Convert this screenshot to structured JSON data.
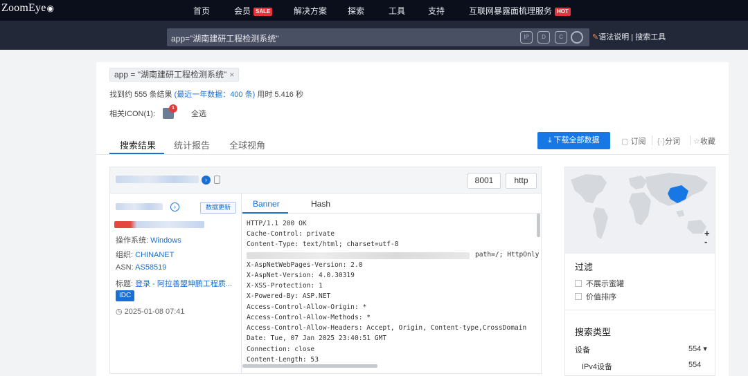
{
  "nav": {
    "logo": "ZoomEye",
    "items": [
      {
        "label": "首页"
      },
      {
        "label": "会员",
        "badge": "SALE"
      },
      {
        "label": "解决方案"
      },
      {
        "label": "探索"
      },
      {
        "label": "工具"
      },
      {
        "label": "支持"
      },
      {
        "label": "互联网暴露面梳理服务",
        "badge": "HOT"
      }
    ]
  },
  "search": {
    "query": "app=\"湖南建研工程检测系统\"",
    "help": "语法说明",
    "tools": "搜索工具",
    "divider": "|"
  },
  "filter_tag": {
    "label": "app = \"湖南建研工程检测系统\"",
    "close": "×"
  },
  "results_summary": {
    "prefix": "找到约 555 条结果",
    "recent": "(最近一年数据：400 条)",
    "time": "用时 5.416 秒"
  },
  "related_icon": {
    "label": "相关ICON(1):",
    "count": "1",
    "select_all": "全选"
  },
  "tabs": [
    {
      "label": "搜索结果",
      "active": true
    },
    {
      "label": "统计报告",
      "active": false
    },
    {
      "label": "全球视角",
      "active": false
    }
  ],
  "actions": {
    "download": "下载全部数据",
    "subscribe": "订阅",
    "share": "分词",
    "favorite": "收藏"
  },
  "result": {
    "port": "8001",
    "service": "http",
    "update_label": "数据更新",
    "os_label": "操作系统:",
    "os_value": "Windows",
    "org_label": "组织:",
    "org_value": "CHINANET",
    "asn_label": "ASN:",
    "asn_value": "AS58519",
    "title_label": "标题:",
    "title_value": "登录 - 阿拉善盟坤鹏工程质...",
    "tag": "IDC",
    "date": "2025-01-08 07:41",
    "banner_tabs": [
      "Banner",
      "Hash"
    ],
    "banner_lines": [
      "HTTP/1.1 200 OK",
      "Cache-Control: private",
      "Content-Type: text/html; charset=utf-8",
      "path=/; HttpOnly",
      "X-AspNetWebPages-Version: 2.0",
      "X-AspNet-Version: 4.0.30319",
      "X-XSS-Protection: 1",
      "X-Powered-By: ASP.NET",
      "Access-Control-Allow-Origin: *",
      "Access-Control-Allow-Methods: *",
      "Access-Control-Allow-Headers: Accept, Origin, Content-type,CrossDomain",
      "Date: Tue, 07 Jan 2025 23:40:51 GMT",
      "Connection: close",
      "Content-Length: 53"
    ]
  },
  "side": {
    "zoom_in": "+",
    "zoom_out": "-",
    "filter_title": "过滤",
    "filters": [
      "不展示蜜罐",
      "价值排序"
    ],
    "type_title": "搜索类型",
    "type_rows": [
      {
        "label": "设备",
        "value": "554 ▾"
      },
      {
        "label": "IPv4设备",
        "value": "554"
      }
    ]
  },
  "colors": {
    "accent": "#1677e5",
    "nav_bg": "#0b0f1c",
    "search_bg": "#222838",
    "badge": "#e8323c"
  }
}
